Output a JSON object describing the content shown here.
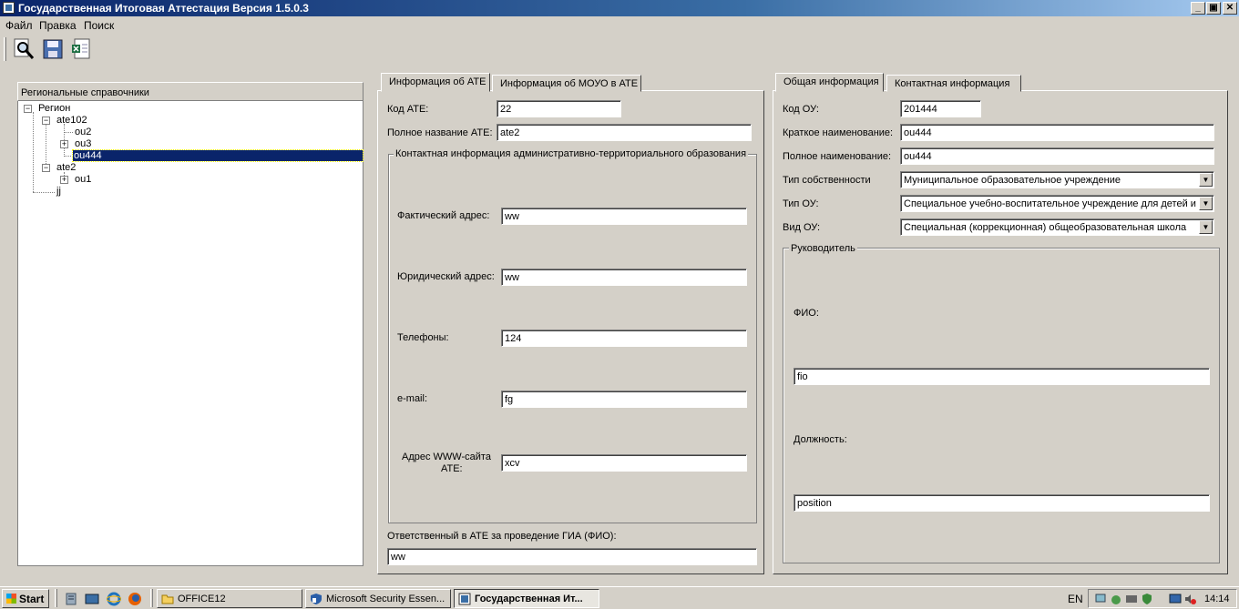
{
  "window": {
    "title": "Государственная Итоговая Аттестация Версия 1.5.0.3",
    "controls": {
      "minimize": "_",
      "maximize": "▣",
      "close": "✕"
    }
  },
  "menu": [
    "Файл",
    "Правка",
    "Поиск"
  ],
  "toolbar": {
    "icons": [
      "search-icon",
      "save-icon",
      "export-excel-icon"
    ]
  },
  "tree": {
    "header": "Региональные справочники",
    "nodes": [
      "Регион",
      "ate102",
      "ou2",
      "ou3",
      "ou444",
      "ate2",
      "ou1",
      "jj"
    ],
    "expand_collapsed": "+",
    "expand_open": "−",
    "selected": "ou444"
  },
  "left_tabs": {
    "tabs": [
      "Информация об АТЕ",
      "Информация об МОУО в АТЕ"
    ],
    "kod_ate": {
      "label": "Код АТЕ:",
      "value": "22"
    },
    "full_name": {
      "label": "Полное название АТЕ:",
      "value": "ate2"
    },
    "contact_group": {
      "title": "Контактная информация административно-территориального образования",
      "fact_address": {
        "label": "Фактический адрес:",
        "value": "ww"
      },
      "legal_address": {
        "label": "Юридический адрес:",
        "value": "ww"
      },
      "phones": {
        "label": "Телефоны:",
        "value": "124"
      },
      "email": {
        "label": "e-mail:",
        "value": "fg"
      },
      "www": {
        "label_line1": "Адрес WWW-сайта",
        "label_line2": "АТЕ:",
        "value": "xcv"
      }
    },
    "responsible": {
      "label": "Ответственный в АТЕ за проведение ГИА (ФИО):",
      "value": "ww"
    }
  },
  "right_tabs": {
    "tabs": [
      "Общая информация",
      "Контактная информация"
    ],
    "kod_ou": {
      "label": "Код ОУ:",
      "value": "201444"
    },
    "short_name": {
      "label": "Краткое наименование:",
      "value": "ou444"
    },
    "full_name": {
      "label": "Полное наименование:",
      "value": "ou444"
    },
    "ownership": {
      "label": "Тип собственности",
      "value": "Муниципальное образовательное учреждение"
    },
    "ou_type": {
      "label": "Тип ОУ:",
      "value": "Специальное учебно-воспитательное учреждение для детей и"
    },
    "ou_kind": {
      "label": "Вид ОУ:",
      "value": "Специальная (коррекционная) общеобразовательная школа"
    },
    "head_group": {
      "title": "Руководитель",
      "fio": {
        "label": "ФИО:",
        "value": "fio"
      },
      "position": {
        "label": "Должность:",
        "value": "position"
      }
    },
    "dropdown_arrow": "▼"
  },
  "taskbar": {
    "start": "Start",
    "tasks": [
      "OFFICE12",
      "Microsoft Security Essen...",
      "Государственная Ит..."
    ],
    "lang": "EN",
    "clock": "14:14"
  },
  "colors": {
    "selection": "#0a246a",
    "title_gradient_start": "#0a246a",
    "face": "#d4d0c8"
  }
}
